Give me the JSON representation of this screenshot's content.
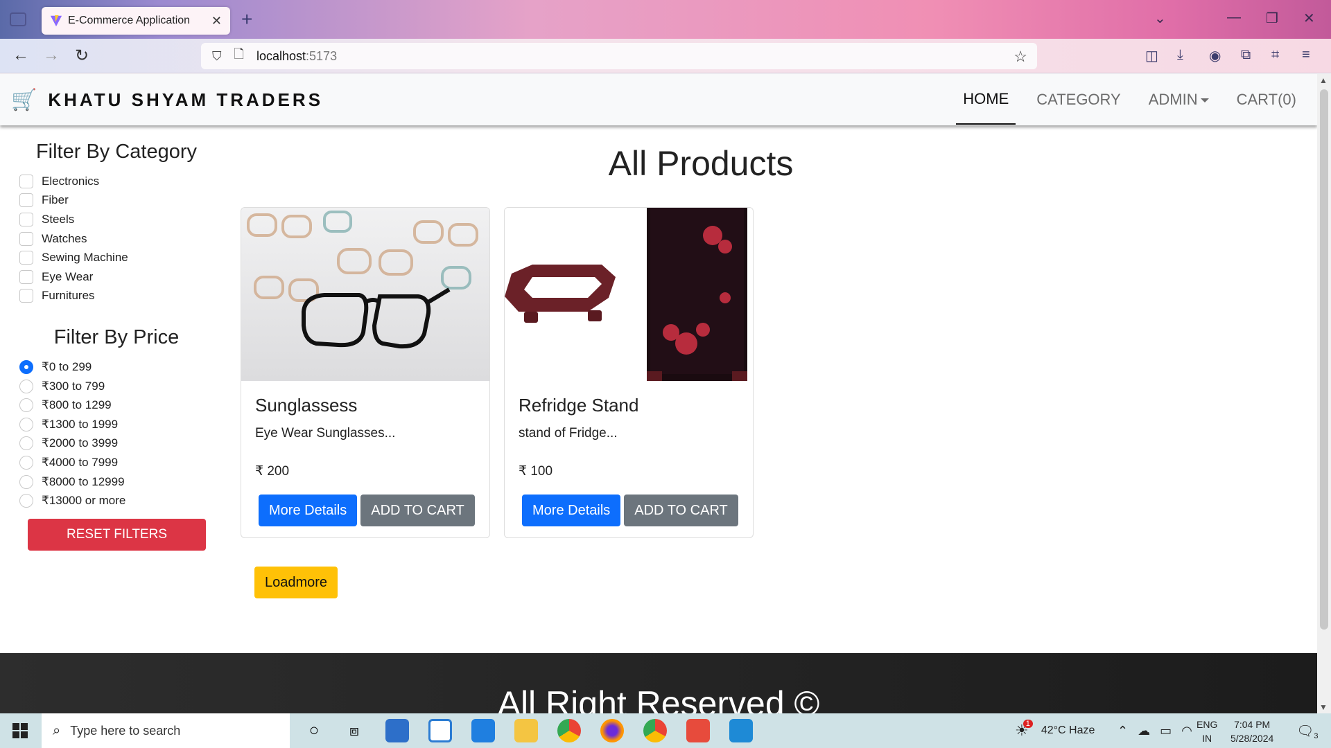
{
  "browser": {
    "tab_title": "E-Commerce Application",
    "url_host": "localhost",
    "url_port": ":5173"
  },
  "site": {
    "brand": "KHATU SHYAM TRADERS",
    "menu": {
      "home": "HOME",
      "category": "CATEGORY",
      "admin": "ADMIN",
      "cart": "CART(0)"
    }
  },
  "filters": {
    "category_title": "Filter By Category",
    "categories": [
      "Electronics",
      "Fiber",
      "Steels",
      "Watches",
      "Sewing Machine",
      "Eye Wear",
      "Furnitures"
    ],
    "price_title": "Filter By Price",
    "prices": [
      "₹0 to 299",
      "₹300 to 799",
      "₹800 to 1299",
      "₹1300 to 1999",
      "₹2000 to 3999",
      "₹4000 to 7999",
      "₹8000 to 12999",
      "₹13000 or more"
    ],
    "selected_price": "₹0 to 299",
    "reset_label": "RESET FILTERS"
  },
  "main": {
    "heading": "All Products",
    "products": [
      {
        "title": "Sunglassess",
        "desc": "Eye Wear Sunglasses...",
        "price": "₹ 200",
        "more": "More Details",
        "cart": "ADD TO CART"
      },
      {
        "title": "Refridge Stand",
        "desc": "stand of Fridge...",
        "price": "₹ 100",
        "more": "More Details",
        "cart": "ADD TO CART"
      }
    ],
    "loadmore": "Loadmore"
  },
  "footer": {
    "text": "All Right Reserved ©"
  },
  "taskbar": {
    "search_placeholder": "Type here to search",
    "weather": "42°C  Haze",
    "weather_badge": "1",
    "lang_top": "ENG",
    "lang_bottom": "IN",
    "time": "7:04 PM",
    "date": "5/28/2024",
    "notifications": "3"
  },
  "colors": {
    "primary": "#0d6efd",
    "danger": "#dc3545",
    "secondary": "#6c757d",
    "warning": "#ffc107"
  }
}
